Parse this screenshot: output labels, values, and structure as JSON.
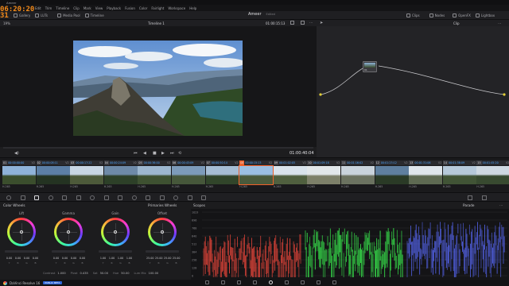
{
  "app": {
    "project_name": "Ameer",
    "project_status": "Edited",
    "timecode": "06:20:20",
    "timecode_frames": "31",
    "version_label": "DaVinci Resolve 16",
    "beta_badge": "PUBLIC BETA"
  },
  "menu": [
    "Edit",
    "Trim",
    "Timeline",
    "Clip",
    "Mark",
    "View",
    "Playback",
    "Fusion",
    "Color",
    "Fairlight",
    "Workspace",
    "Help"
  ],
  "toolbar": {
    "gallery": "Gallery",
    "luts": "LUTs",
    "media_pool": "Media Pool",
    "timeline": "Timeline",
    "clips": "Clips",
    "nodes": "Nodes",
    "openfx": "OpenFX",
    "lightbox": "Lightbox"
  },
  "viewer": {
    "zoom": "19%",
    "timeline_name": "Timeline 1",
    "source_tc": "01:00:15:13",
    "playhead_tc": "01:00:40:04",
    "clip_mode": "Clip"
  },
  "node": {
    "label": "01"
  },
  "clips": [
    {
      "num": "01",
      "tc": "00:00:00:00",
      "track": "V2",
      "name": "H.265",
      "sky": "#8fb3d9",
      "ground": "#3b4e2d"
    },
    {
      "num": "02",
      "tc": "00:00:08:11",
      "track": "V2",
      "name": "H.265",
      "sky": "#5c7fa6",
      "ground": "#243322"
    },
    {
      "num": "03",
      "tc": "00:00:17:22",
      "track": "V2",
      "name": "H.265",
      "sky": "#c8d6e4",
      "ground": "#4d5a3a"
    },
    {
      "num": "04",
      "tc": "00:00:24:09",
      "track": "V2",
      "name": "H.265",
      "sky": "#6e8aa8",
      "ground": "#2d4028"
    },
    {
      "num": "05",
      "tc": "00:00:36:00",
      "track": "V2",
      "name": "H.265",
      "sky": "#9db7cf",
      "ground": "#3e5131"
    },
    {
      "num": "06",
      "tc": "00:00:43:09",
      "track": "V2",
      "name": "H.265",
      "sky": "#7d9bba",
      "ground": "#46573a"
    },
    {
      "num": "07",
      "tc": "00:00:50:14",
      "track": "V2",
      "name": "H.265",
      "sky": "#a6bdd4",
      "ground": "#31452a"
    },
    {
      "num": "08",
      "tc": "00:00:15:13",
      "track": "V2",
      "name": "H.265",
      "sky": "#9bbfe3",
      "ground": "#4a5a3c",
      "selected": true
    },
    {
      "num": "09",
      "tc": "00:01:02:05",
      "track": "V2",
      "name": "H.265",
      "sky": "#d9e3ec",
      "ground": "#50603f"
    },
    {
      "num": "10",
      "tc": "00:01:09:18",
      "track": "V2",
      "name": "H.265",
      "sky": "#e2e7ea",
      "ground": "#7d8069"
    },
    {
      "num": "11",
      "tc": "00:01:16:02",
      "track": "V2",
      "name": "H.265",
      "sky": "#c9d3dc",
      "ground": "#6b7260"
    },
    {
      "num": "12",
      "tc": "00:01:23:12",
      "track": "V2",
      "name": "H.265",
      "sky": "#5f7f9f",
      "ground": "#2a3a26"
    },
    {
      "num": "13",
      "tc": "00:01:31:06",
      "track": "V2",
      "name": "H.265",
      "sky": "#dfe6ec",
      "ground": "#5e6a52"
    },
    {
      "num": "14",
      "tc": "00:01:38:09",
      "track": "V2",
      "name": "H.265",
      "sky": "#b6c9da",
      "ground": "#415436"
    },
    {
      "num": "15",
      "tc": "00:01:45:20",
      "track": "V2",
      "name": "H.265",
      "sky": "#cfd9e2",
      "ground": "#384a30"
    }
  ],
  "color_wheels": {
    "panel_title": "Color Wheels",
    "mode": "Primaries Wheels",
    "wheels": [
      {
        "name": "Lift",
        "values": [
          "0.00",
          "0.00",
          "0.00",
          "0.00"
        ]
      },
      {
        "name": "Gamma",
        "values": [
          "0.00",
          "0.00",
          "0.00",
          "0.00"
        ]
      },
      {
        "name": "Gain",
        "values": [
          "1.00",
          "1.00",
          "1.00",
          "1.00"
        ]
      },
      {
        "name": "Offset",
        "values": [
          "25.00",
          "25.00",
          "25.00",
          "25.00"
        ]
      }
    ],
    "channel_labels": [
      "Y",
      "R",
      "G",
      "B"
    ],
    "contrast_label": "Contrast",
    "contrast": "1.000",
    "pivot_label": "Pivot",
    "pivot": "0.435",
    "sat_label": "Sat",
    "sat": "50.00",
    "hue_label": "Hue",
    "hue": "50.00",
    "lummix_label": "Lum Mix",
    "lummix": "100.00"
  },
  "scopes": {
    "title": "Scopes",
    "mode": "Parade",
    "scale": [
      "1023",
      "896",
      "768",
      "640",
      "512",
      "384",
      "256",
      "128",
      "0"
    ],
    "colors": {
      "red": "#ff4b3e",
      "green": "#3cff52",
      "blue": "#5a6bff"
    }
  },
  "bottom_nav_icons": [
    "media-page-icon",
    "cut-page-icon",
    "edit-page-icon",
    "fusion-page-icon",
    "color-page-icon",
    "fairlight-page-icon",
    "deliver-page-icon",
    "home-icon",
    "settings-icon"
  ]
}
